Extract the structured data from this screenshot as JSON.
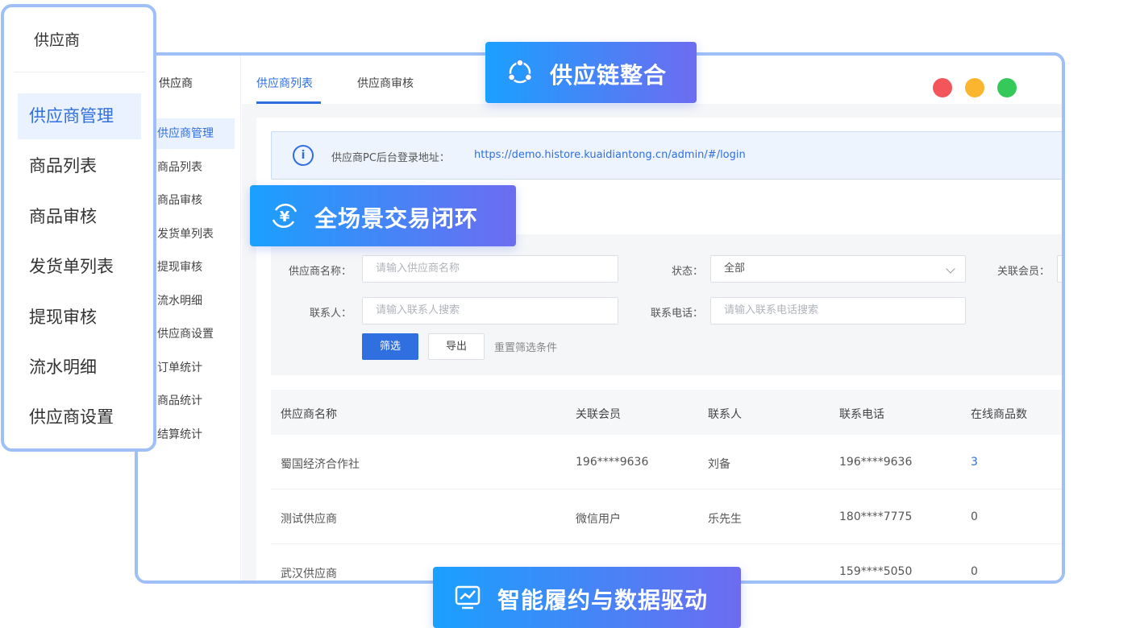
{
  "panel": {
    "title": "供应商",
    "items": [
      {
        "label": "供应商管理",
        "active": true
      },
      {
        "label": "商品列表",
        "active": false
      },
      {
        "label": "商品审核",
        "active": false
      },
      {
        "label": "发货单列表",
        "active": false
      },
      {
        "label": "提现审核",
        "active": false
      },
      {
        "label": "流水明细",
        "active": false
      },
      {
        "label": "供应商设置",
        "active": false
      }
    ]
  },
  "sidebar": {
    "title": "供应商",
    "items": [
      {
        "label": "供应商管理",
        "active": true
      },
      {
        "label": "商品列表"
      },
      {
        "label": "商品审核"
      },
      {
        "label": "发货单列表"
      },
      {
        "label": "提现审核"
      },
      {
        "label": "流水明细"
      },
      {
        "label": "供应商设置"
      },
      {
        "label": "订单统计"
      },
      {
        "label": "商品统计"
      },
      {
        "label": "结算统计"
      }
    ]
  },
  "tabs": [
    {
      "label": "供应商列表",
      "active": true
    },
    {
      "label": "供应商审核",
      "active": false
    }
  ],
  "window_dots": {
    "colors": [
      "#f2565a",
      "#fbb52e",
      "#35c95a"
    ]
  },
  "notice": {
    "label": "供应商PC后台登录地址：",
    "url": "https://demo.histore.kuaidiantong.cn/admin/#/login"
  },
  "filters": {
    "name_label": "供应商名称：",
    "name_placeholder": "请输入供应商名称",
    "status_label": "状态：",
    "status_value": "全部",
    "member_label": "关联会员：",
    "contact_label": "联系人：",
    "contact_placeholder": "请输入联系人搜索",
    "phone_label": "联系电话：",
    "phone_placeholder": "请输入联系电话搜索",
    "filter_button": "筛选",
    "export_button": "导出",
    "reset_link": "重置筛选条件"
  },
  "table": {
    "headers": [
      "供应商名称",
      "关联会员",
      "联系人",
      "联系电话",
      "在线商品数"
    ],
    "rows": [
      {
        "name": "蜀国经济合作社",
        "member": "196****9636",
        "contact": "刘备",
        "phone": "196****9636",
        "count": "3"
      },
      {
        "name": "测试供应商",
        "member": "微信用户",
        "contact": "乐先生",
        "phone": "180****7775",
        "count": "0"
      },
      {
        "name": "武汉供应商",
        "member": "",
        "contact": "",
        "phone": "159****5050",
        "count": "0"
      }
    ]
  },
  "badges": {
    "supply_chain": "供应链整合",
    "trade_loop": "全场景交易闭环",
    "smart": "智能履约与数据驱动"
  },
  "colors": {
    "accent": "#2f6fe0",
    "border": "#9fc0f7",
    "badge_from": "#1aa0ff",
    "badge_to": "#6d6cf0"
  }
}
